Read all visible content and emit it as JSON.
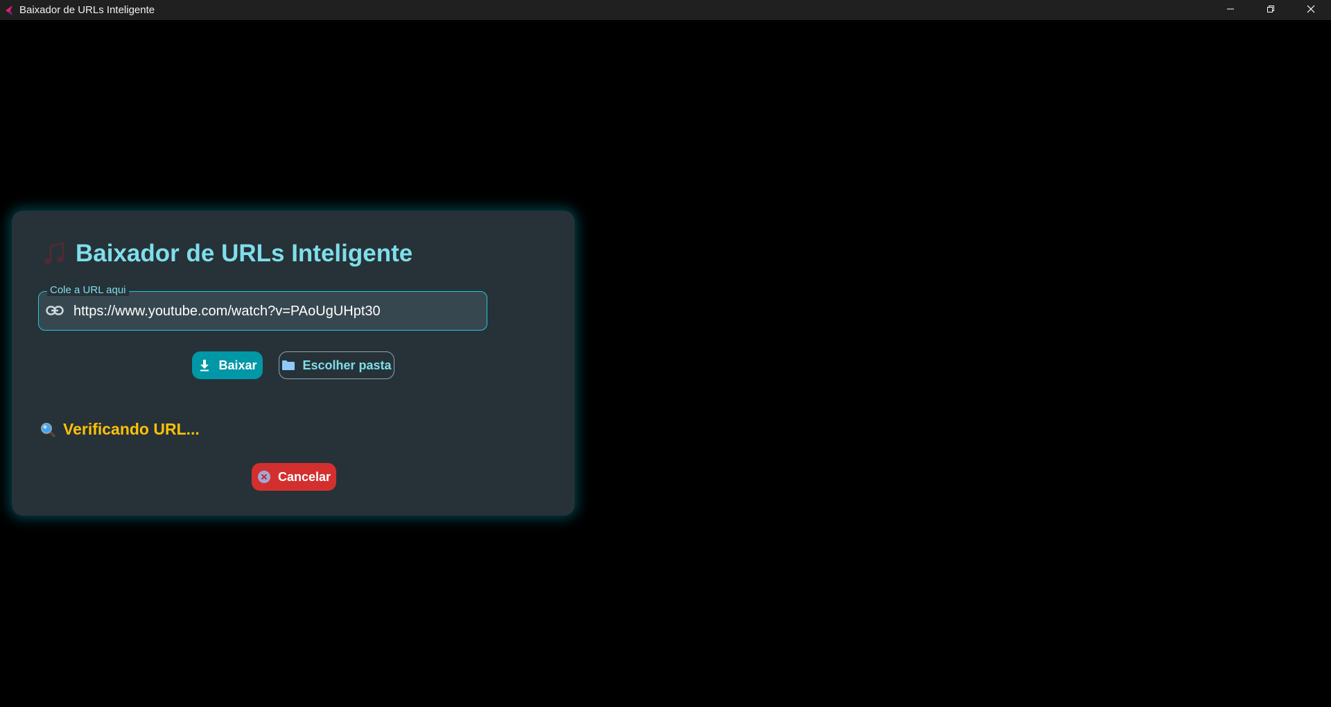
{
  "window": {
    "title": "Baixador de URLs Inteligente",
    "icon": "app-logo-icon",
    "controls": [
      "minimize-icon",
      "restore-icon",
      "close-icon"
    ]
  },
  "card": {
    "header_icon": "music-note-icon",
    "title": "Baixador de URLs Inteligente",
    "url_field": {
      "label": "Cole a URL aqui",
      "icon": "link-icon",
      "value": "https://www.youtube.com/watch?v=PAoUgUHpt30"
    },
    "buttons": {
      "download_label": "Baixar",
      "download_icon": "download-icon",
      "folder_label": "Escolher pasta",
      "folder_icon": "folder-icon"
    },
    "status": {
      "icon": "magnifier-icon",
      "text": "Verificando URL..."
    },
    "cancel": {
      "label": "Cancelar",
      "icon": "cancel-circle-icon"
    }
  },
  "colors": {
    "background": "#000000",
    "card": "#263238",
    "accent": "#80deea",
    "primary_button": "#0097a7",
    "status_text": "#ffc107",
    "cancel_button": "#d32f2f"
  }
}
